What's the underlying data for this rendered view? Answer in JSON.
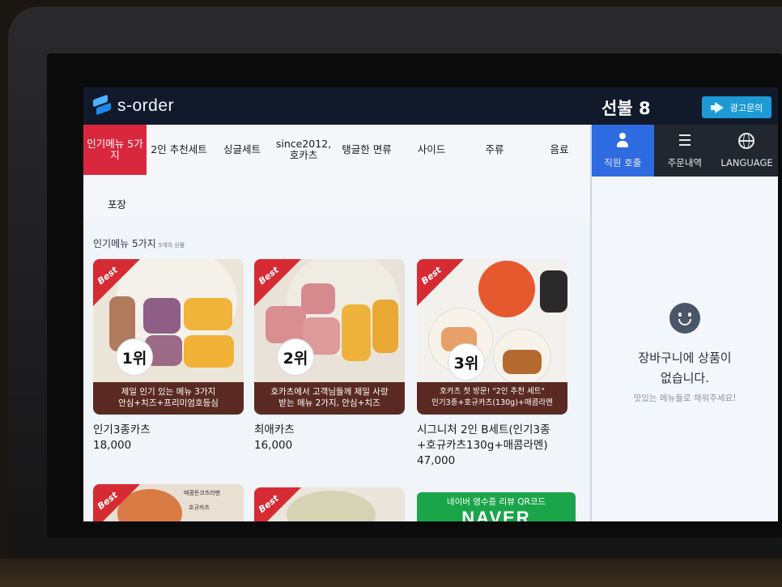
{
  "header": {
    "logo_text": "s-order",
    "table_name": "선불 8",
    "ad_button_label": "광고문의"
  },
  "categories": [
    {
      "label": "인기메뉴 5가지",
      "active": true
    },
    {
      "label": "2인 추천세트",
      "active": false
    },
    {
      "label": "싱글세트",
      "active": false
    },
    {
      "label": "since2012,호카츠",
      "active": false
    },
    {
      "label": "탱글한 면류",
      "active": false
    },
    {
      "label": "사이드",
      "active": false
    },
    {
      "label": "주류",
      "active": false
    },
    {
      "label": "음료",
      "active": false
    },
    {
      "label": "포장",
      "active": false
    }
  ],
  "section": {
    "title": "인기메뉴 5가지",
    "count": "5개의 상품"
  },
  "menu_items": [
    {
      "badge": "Best",
      "rank": "1위",
      "banner_line1": "제일 인기 있는 메뉴 3가지",
      "banner_line2": "안심+치즈+프리미엄호등심",
      "name": "인기3종카츠",
      "price": "18,000"
    },
    {
      "badge": "Best",
      "rank": "2위",
      "banner_line1": "호카츠에서 고객님들께 제일 사랑",
      "banner_line2": "받는 메뉴 2가지, 안심+치즈",
      "name": "최애카츠",
      "price": "16,000"
    },
    {
      "badge": "Best",
      "rank": "3위",
      "banner_line1": "호카츠 첫 방문! \"2인 추천 세트\"",
      "banner_line2": "인기3종+호규카츠(130g)+매콤라멘",
      "name": "시그니처 2인 B세트(인기3종+호규카츠130g+매콤라멘)",
      "price": "47,000"
    },
    {
      "badge": "Best",
      "side_text_1": "매콤돈코츠라멘",
      "side_text_2": "호규카츠"
    },
    {
      "badge": "Best"
    }
  ],
  "naver_card": {
    "line1": "네이버 영수증 리뷰 QR코드",
    "line2": "NAVER"
  },
  "right_panel": {
    "tabs": [
      {
        "label": "직원 호출",
        "icon": "person-icon",
        "active": true
      },
      {
        "label": "주문내역",
        "icon": "list-icon",
        "active": false
      },
      {
        "label": "LANGUAGE",
        "icon": "globe-icon",
        "active": false
      }
    ],
    "cart_empty_line1": "장바구니에 상품이",
    "cart_empty_line2": "없습니다.",
    "cart_empty_sub": "맛있는 메뉴들로 채워주세요!"
  },
  "colors": {
    "accent_red": "#d9283e",
    "active_blue": "#2f6be0",
    "header_navy": "#101a2b",
    "ad_blue": "#1d9ad6",
    "naver_green": "#1aa54a"
  }
}
